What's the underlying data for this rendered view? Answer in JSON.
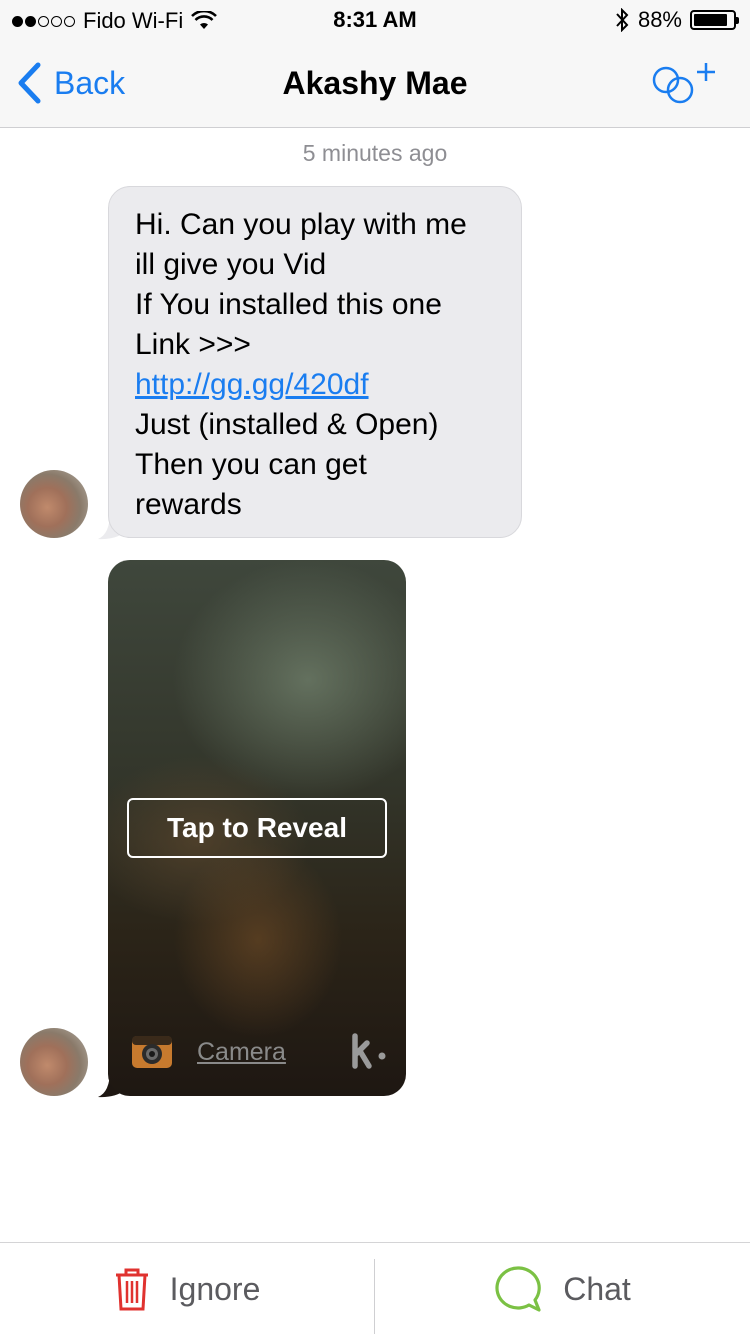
{
  "status_bar": {
    "carrier": "Fido Wi-Fi",
    "signal_bars_filled": 2,
    "signal_bars_total": 5,
    "time": "8:31 AM",
    "battery": "88%",
    "battery_level": 0.88
  },
  "nav": {
    "back_label": "Back",
    "title": "Akashy Mae",
    "accent_color": "#1a7df0"
  },
  "conversation": {
    "timestamp": "5 minutes ago",
    "message": {
      "lines": [
        "Hi. Can you play with me",
        "ill give you Vid",
        "If You installed this one",
        "Link >>>"
      ],
      "link": "http://gg.gg/420df",
      "lines_after": [
        "Just (installed & Open)",
        "Then you can get",
        "rewards"
      ]
    },
    "media": {
      "reveal_label": "Tap to Reveal",
      "source_label": "Camera",
      "icon": "kik-logo"
    }
  },
  "bottom_bar": {
    "ignore_label": "Ignore",
    "chat_label": "Chat",
    "ignore_color": "#e0322f",
    "chat_color": "#7bc144"
  }
}
